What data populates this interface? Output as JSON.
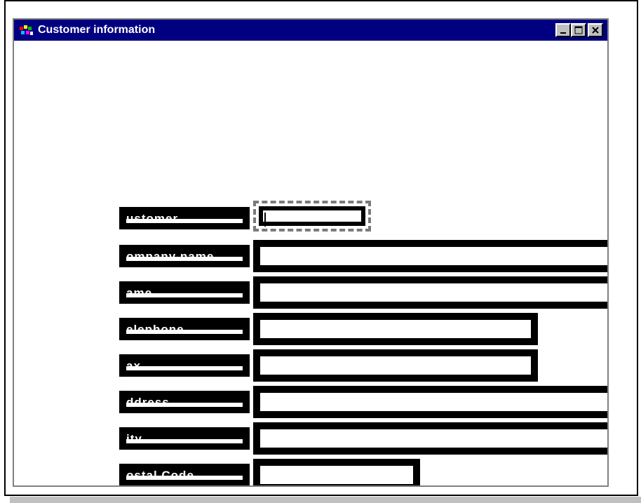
{
  "window": {
    "title": "Customer information"
  },
  "icons": {
    "app": "app-icon",
    "minimize": "minimize-icon",
    "maximize": "maximize-icon",
    "close": "close-icon"
  },
  "fields": [
    {
      "key": "customer",
      "label": "ustomer",
      "value": ""
    },
    {
      "key": "company_name",
      "label": "ompany name",
      "value": ""
    },
    {
      "key": "name",
      "label": "ame",
      "value": ""
    },
    {
      "key": "telephone",
      "label": "elephone",
      "value": ""
    },
    {
      "key": "fax",
      "label": "ax",
      "value": ""
    },
    {
      "key": "address",
      "label": "ddress",
      "value": ""
    },
    {
      "key": "city",
      "label": "ity",
      "value": ""
    },
    {
      "key": "postal_code",
      "label": "ostal Code",
      "value": ""
    }
  ],
  "colors": {
    "titlebar": "#000080",
    "control_fill": "#000000",
    "field_background": "#ffffff"
  }
}
